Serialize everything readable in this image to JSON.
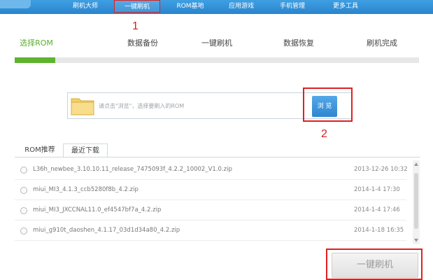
{
  "nav": {
    "items": [
      {
        "label": "刷机大师"
      },
      {
        "label": "一键刷机"
      },
      {
        "label": "ROM基地"
      },
      {
        "label": "应用游戏"
      },
      {
        "label": "手机管理"
      },
      {
        "label": "更多工具"
      }
    ]
  },
  "annotations": {
    "one": "1",
    "two": "2"
  },
  "steps": [
    {
      "label": "选择ROM"
    },
    {
      "label": "数据备份"
    },
    {
      "label": "一键刷机"
    },
    {
      "label": "数据恢复"
    },
    {
      "label": "刷机完成"
    }
  ],
  "progress": {
    "percent": 10
  },
  "rom": {
    "hint": "请点击\"浏览\"，选择要刷入的ROM",
    "browse_label": "浏 览"
  },
  "tabs": [
    {
      "label": "ROM推荐"
    },
    {
      "label": "最近下载"
    }
  ],
  "files": [
    {
      "name": "L36h_newbee_3.10.10.11_release_7475093f_4.2.2_10002_V1.0.zip",
      "date": "2013-12-26 10:32"
    },
    {
      "name": "miui_MI3_4.1.3_ccb5280f8b_4.2.zip",
      "date": "2014-1-4 17:30"
    },
    {
      "name": "miui_MI3_JXCCNAL11.0_ef4547bf7a_4.2.zip",
      "date": "2014-1-4 17:46"
    },
    {
      "name": "miui_g910t_daoshen_4.1.17_03d1d34a80_4.2.zip",
      "date": "2014-1-18 16:35"
    }
  ],
  "flash_button": {
    "label": "一键刷机"
  },
  "colors": {
    "accent": "#5eb42f",
    "nav": "#2a84cc",
    "highlight": "#e02020"
  }
}
